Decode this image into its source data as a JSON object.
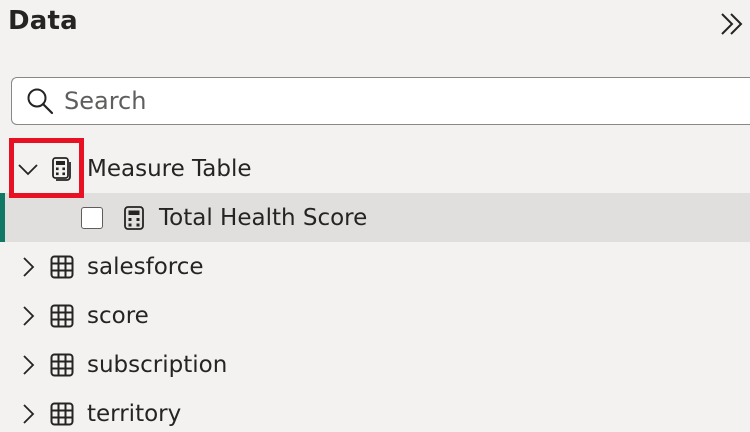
{
  "pane": {
    "title": "Data",
    "collapse_icon": "double-chevron-right-icon"
  },
  "search": {
    "placeholder": "Search",
    "value": "",
    "icon": "search-icon"
  },
  "tree": {
    "measure_table": {
      "label": "Measure Table",
      "expanded": true,
      "icon": "calculator-stack-icon",
      "children": [
        {
          "label": "Total Health Score",
          "icon": "calculator-icon",
          "checked": false,
          "selected": true
        }
      ]
    },
    "tables": [
      {
        "label": "salesforce",
        "icon": "table-grid-icon",
        "expanded": false
      },
      {
        "label": "score",
        "icon": "table-grid-icon",
        "expanded": false
      },
      {
        "label": "subscription",
        "icon": "table-grid-icon",
        "expanded": false
      },
      {
        "label": "territory",
        "icon": "table-grid-icon",
        "expanded": false
      }
    ]
  },
  "colors": {
    "background": "#f3f2f1",
    "selected_row": "#e1dfdd",
    "accent": "#117865",
    "highlight": "#e81123"
  }
}
